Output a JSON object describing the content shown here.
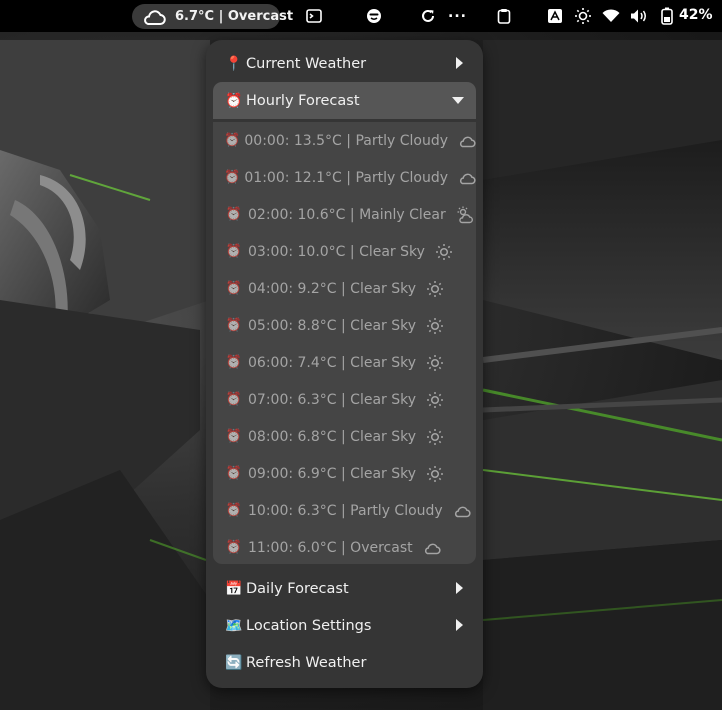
{
  "panel": {
    "weather_indicator": {
      "icon": "cloud-icon",
      "text": "6.7°C | Overcast"
    },
    "icons": [
      "terminal-icon",
      "emote-icon",
      "refresh-icon",
      "clipboard-icon",
      "keyboard-icon",
      "brightness-icon",
      "wifi-icon",
      "volume-icon",
      "battery-icon"
    ],
    "overflow": "...",
    "battery_percent": "42%"
  },
  "menu": {
    "current_weather": {
      "emoji": "📍",
      "label": "Current Weather"
    },
    "hourly_forecast": {
      "emoji": "⏰",
      "label": "Hourly Forecast",
      "items": [
        {
          "emoji": "⏰",
          "label": "00:00: 13.5°C | Partly Cloudy",
          "icon": "cloud-icon"
        },
        {
          "emoji": "⏰",
          "label": "01:00: 12.1°C | Partly Cloudy",
          "icon": "cloud-icon"
        },
        {
          "emoji": "⏰",
          "label": "02:00: 10.6°C | Mainly Clear",
          "icon": "sun-cloud-icon"
        },
        {
          "emoji": "⏰",
          "label": "03:00: 10.0°C | Clear Sky",
          "icon": "sun-icon"
        },
        {
          "emoji": "⏰",
          "label": "04:00: 9.2°C | Clear Sky",
          "icon": "sun-icon"
        },
        {
          "emoji": "⏰",
          "label": "05:00: 8.8°C | Clear Sky",
          "icon": "sun-icon"
        },
        {
          "emoji": "⏰",
          "label": "06:00: 7.4°C | Clear Sky",
          "icon": "sun-icon"
        },
        {
          "emoji": "⏰",
          "label": "07:00: 6.3°C | Clear Sky",
          "icon": "sun-icon"
        },
        {
          "emoji": "⏰",
          "label": "08:00: 6.8°C | Clear Sky",
          "icon": "sun-icon"
        },
        {
          "emoji": "⏰",
          "label": "09:00: 6.9°C | Clear Sky",
          "icon": "sun-icon"
        },
        {
          "emoji": "⏰",
          "label": "10:00: 6.3°C | Partly Cloudy",
          "icon": "cloud-icon"
        },
        {
          "emoji": "⏰",
          "label": "11:00: 6.0°C | Overcast",
          "icon": "cloud-icon"
        }
      ]
    },
    "daily_forecast": {
      "emoji": "📅",
      "label": "Daily Forecast"
    },
    "location_settings": {
      "emoji": "🗺️",
      "label": "Location Settings"
    },
    "refresh_weather": {
      "emoji": "🔄",
      "label": "Refresh Weather"
    }
  },
  "colors": {
    "panel_bg": "#000000",
    "menu_bg": "#353535",
    "submenu_bg": "#454545",
    "open_item_bg": "#565656",
    "accent_green": "#6fd13a"
  }
}
